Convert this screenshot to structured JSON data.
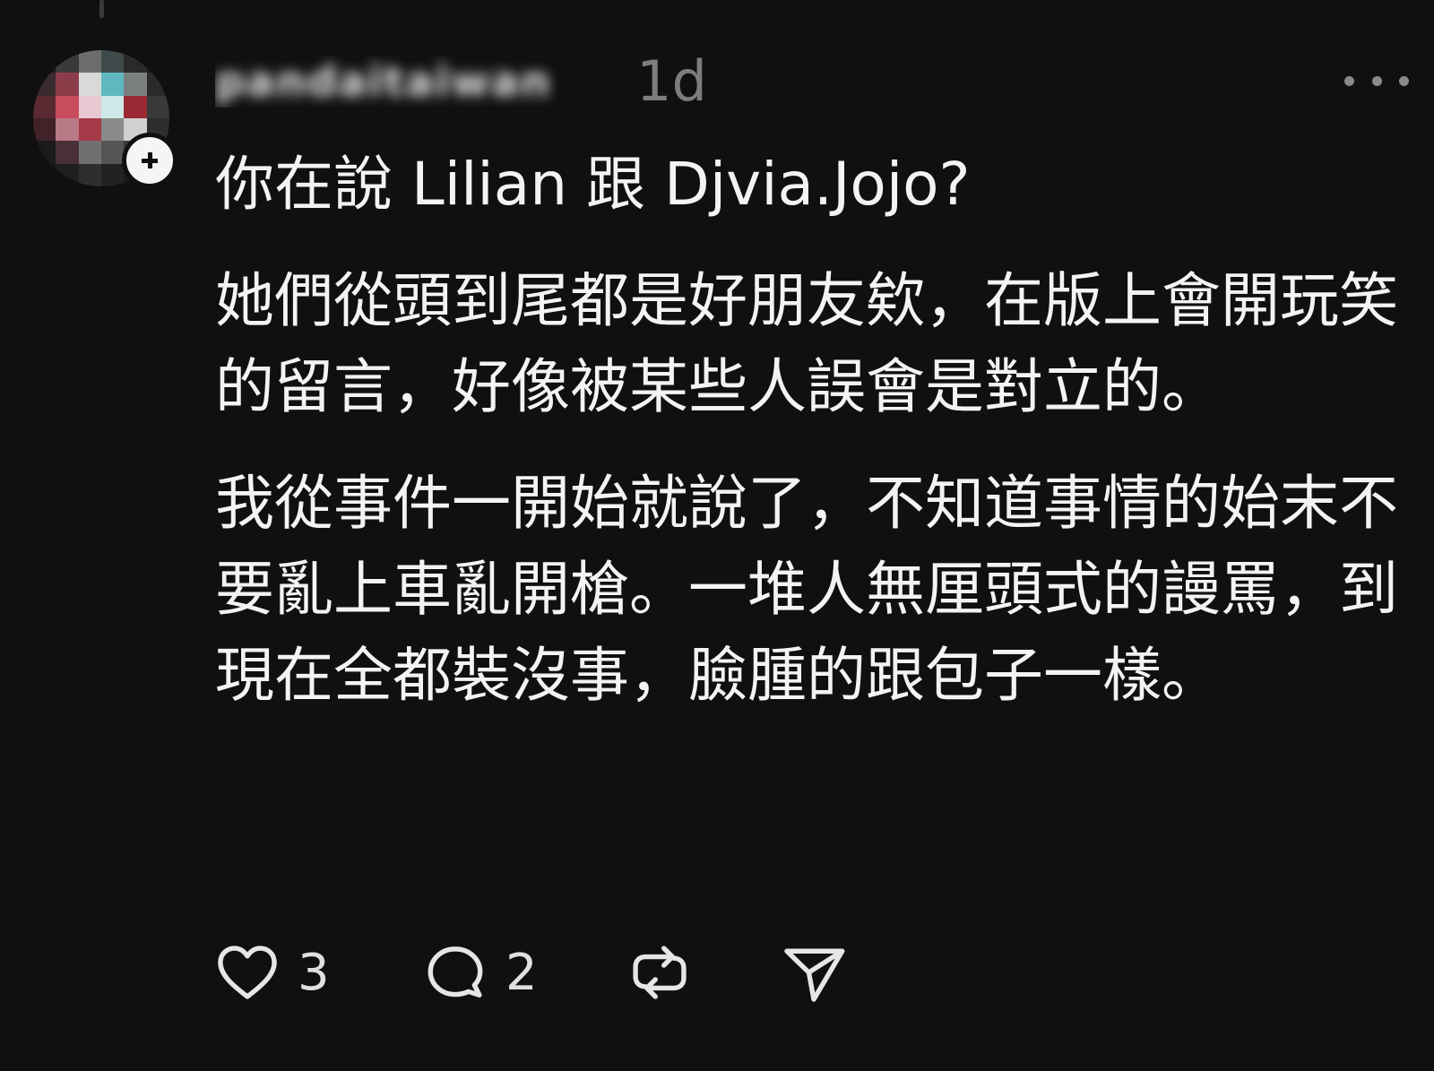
{
  "post": {
    "username": "pandaitaiwan",
    "timestamp": "1d",
    "paragraphs": [
      "你在說 Lilian 跟 Djvia.Jojo?",
      "她們從頭到尾都是好朋友欸，在版上會開玩笑的留言，好像被某些人誤會是對立的。",
      "我從事件一開始就說了，不知道事情的始末不要亂上車亂開槍。一堆人無厘頭式的謾罵，到現在全都裝沒事，臉腫的跟包子一樣。"
    ]
  },
  "actions": {
    "like_count": "3",
    "reply_count": "2"
  },
  "icons": {
    "more": "more-horizontal-icon",
    "like": "heart-icon",
    "reply": "comment-bubble-icon",
    "repost": "repost-icon",
    "share": "send-icon"
  },
  "colors": {
    "background": "#101010",
    "text": "#f3f3f3",
    "muted": "#7d7d7d"
  }
}
